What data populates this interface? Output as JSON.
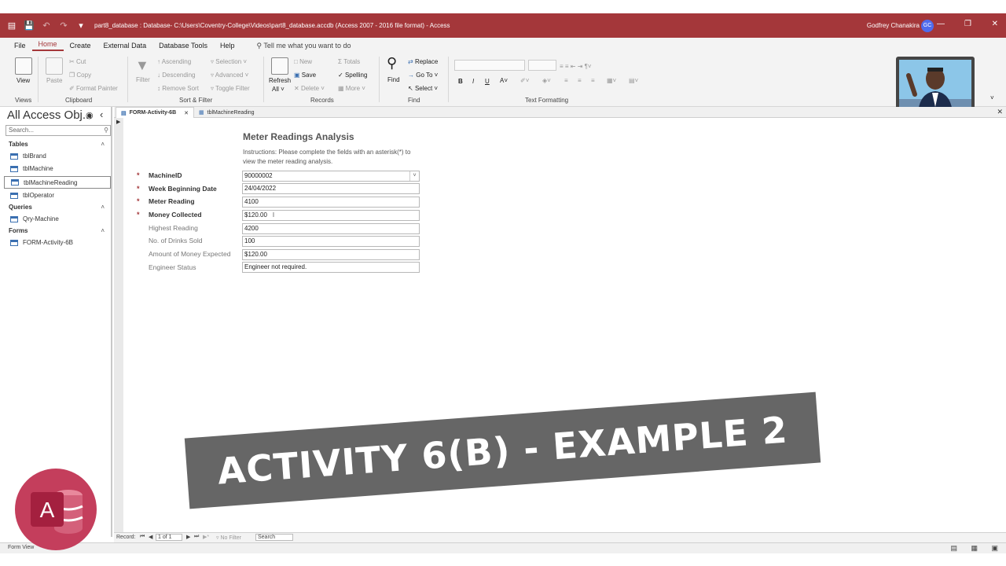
{
  "window": {
    "title": "part8_database : Database- C:\\Users\\Coventry-College\\Videos\\part8_database.accdb (Access 2007 - 2016 file format)  -  Access",
    "user_name": "Godfrey Chanakira",
    "user_initials": "GC"
  },
  "menu": {
    "items": [
      "File",
      "Home",
      "Create",
      "External Data",
      "Database Tools",
      "Help"
    ],
    "active": "Home",
    "tell_me": "Tell me what you want to do"
  },
  "ribbon": {
    "groups": {
      "views": "Views",
      "clipboard": "Clipboard",
      "sort_filter": "Sort & Filter",
      "records": "Records",
      "find": "Find",
      "text_formatting": "Text Formatting"
    },
    "view": "View",
    "paste": "Paste",
    "cut": "Cut",
    "copy": "Copy",
    "format_painter": "Format Painter",
    "filter": "Filter",
    "ascending": "Ascending",
    "descending": "Descending",
    "remove_sort": "Remove Sort",
    "selection": "Selection",
    "advanced": "Advanced",
    "toggle_filter": "Toggle Filter",
    "refresh": "Refresh",
    "refresh_all": "All",
    "new": "New",
    "save": "Save",
    "delete": "Delete",
    "totals": "Totals",
    "spelling": "Spelling",
    "more": "More",
    "find": "Find",
    "replace": "Replace",
    "go_to": "Go To",
    "select": "Select",
    "bold": "B",
    "italic": "I",
    "underline": "U"
  },
  "nav_pane": {
    "title": "All Access Obj...",
    "search_placeholder": "Search...",
    "sections": [
      {
        "name": "Tables",
        "items": [
          "tblBrand",
          "tblMachine",
          "tblMachineReading",
          "tblOperator"
        ]
      },
      {
        "name": "Queries",
        "items": [
          "Qry-Machine"
        ]
      },
      {
        "name": "Forms",
        "items": [
          "FORM-Activity-6B"
        ]
      }
    ],
    "selected_item": "tblMachineReading"
  },
  "doc_tabs": [
    {
      "label": "FORM-Activity-6B",
      "active": true
    },
    {
      "label": "tblMachineReading",
      "active": false
    }
  ],
  "form": {
    "title": "Meter Readings Analysis",
    "instructions": "Instructions: Please complete the fields with an asterisk(*) to view the meter reading analysis.",
    "fields": [
      {
        "label": "MachineID",
        "value": "90000002",
        "required": true
      },
      {
        "label": "Week Beginning Date",
        "value": "24/04/2022",
        "required": true
      },
      {
        "label": "Meter Reading",
        "value": "4100",
        "required": true
      },
      {
        "label": "Money Collected",
        "value": "$120.00",
        "required": true
      },
      {
        "label": "Highest Reading",
        "value": "4200",
        "required": false
      },
      {
        "label": "No. of Drinks Sold",
        "value": "100",
        "required": false
      },
      {
        "label": "Amount of Money Expected",
        "value": "$120.00",
        "required": false
      },
      {
        "label": "Engineer Status",
        "value": "Engineer not required.",
        "required": false
      }
    ]
  },
  "record_bar": {
    "record_label": "Record:",
    "position": "1 of 1",
    "no_filter": "No Filter",
    "search": "Search"
  },
  "status_bar": {
    "view": "Form View"
  },
  "banner": {
    "text": "ACTIVITY 6(B) - EXAMPLE 2"
  },
  "logo": {
    "letter": "A"
  },
  "colors": {
    "accent": "#a4373a",
    "banner": "#666666",
    "logo": "#c43e5c"
  }
}
